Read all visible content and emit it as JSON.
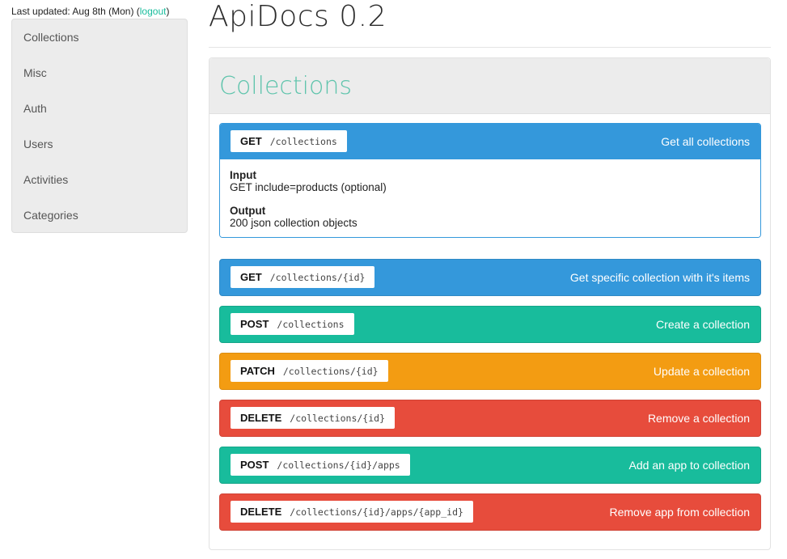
{
  "header": {
    "updated_prefix": "Last updated: Aug 8th (Mon) (",
    "logout_label": "logout",
    "updated_suffix": ")",
    "app_title": "ApiDocs 0.2"
  },
  "sidebar": {
    "items": [
      {
        "label": "Collections"
      },
      {
        "label": "Misc"
      },
      {
        "label": "Auth"
      },
      {
        "label": "Users"
      },
      {
        "label": "Activities"
      },
      {
        "label": "Categories"
      }
    ]
  },
  "section": {
    "title": "Collections",
    "endpoints": [
      {
        "method": "GET",
        "path": "/collections",
        "description": "Get all collections",
        "color": "#3498db",
        "input_label": "Input",
        "input_value": "GET include=products (optional)",
        "output_label": "Output",
        "output_value": "200 json collection objects"
      },
      {
        "method": "GET",
        "path": "/collections/{id}",
        "description": "Get specific collection with it's items",
        "color": "#3498db"
      },
      {
        "method": "POST",
        "path": "/collections",
        "description": "Create a collection",
        "color": "#18bc9c"
      },
      {
        "method": "PATCH",
        "path": "/collections/{id}",
        "description": "Update a collection",
        "color": "#f39c12"
      },
      {
        "method": "DELETE",
        "path": "/collections/{id}",
        "description": "Remove a collection",
        "color": "#e74c3c"
      },
      {
        "method": "POST",
        "path": "/collections/{id}/apps",
        "description": "Add an app to collection",
        "color": "#18bc9c"
      },
      {
        "method": "DELETE",
        "path": "/collections/{id}/apps/{app_id}",
        "description": "Remove app from collection",
        "color": "#e74c3c"
      }
    ]
  }
}
